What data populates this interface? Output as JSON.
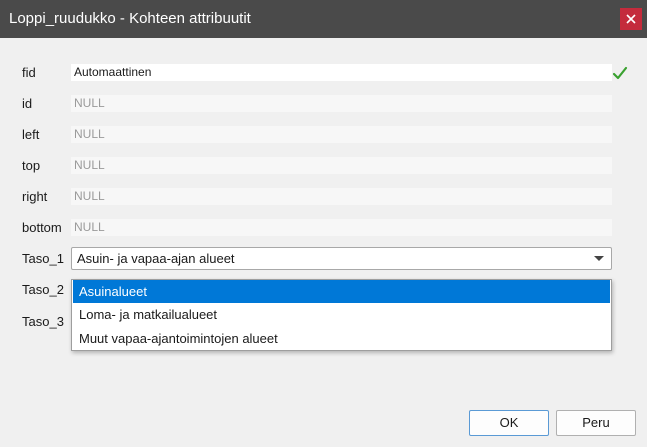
{
  "window": {
    "title": "Loppi_ruudukko - Kohteen attribuutit",
    "close_icon": "close-icon"
  },
  "fields": {
    "fid": {
      "label": "fid",
      "value": "Automaattinen",
      "status_icon": "check-icon",
      "status_color": "#3aa130"
    },
    "id": {
      "label": "id",
      "value": "NULL"
    },
    "left": {
      "label": "left",
      "value": "NULL"
    },
    "top": {
      "label": "top",
      "value": "NULL"
    },
    "right": {
      "label": "right",
      "value": "NULL"
    },
    "bottom": {
      "label": "bottom",
      "value": "NULL"
    },
    "taso_1": {
      "label": "Taso_1",
      "value": "Asuin- ja vapaa-ajan alueet"
    },
    "taso_2": {
      "label": "Taso_2"
    },
    "taso_3": {
      "label": "Taso_3"
    }
  },
  "dropdown": {
    "options": [
      "Asuinalueet",
      "Loma- ja matkailualueet",
      "Muut vapaa-ajantoimintojen alueet"
    ],
    "highlighted": "Asuinalueet",
    "highlight_color": "#0078d7"
  },
  "buttons": {
    "ok": "OK",
    "cancel": "Peru"
  }
}
